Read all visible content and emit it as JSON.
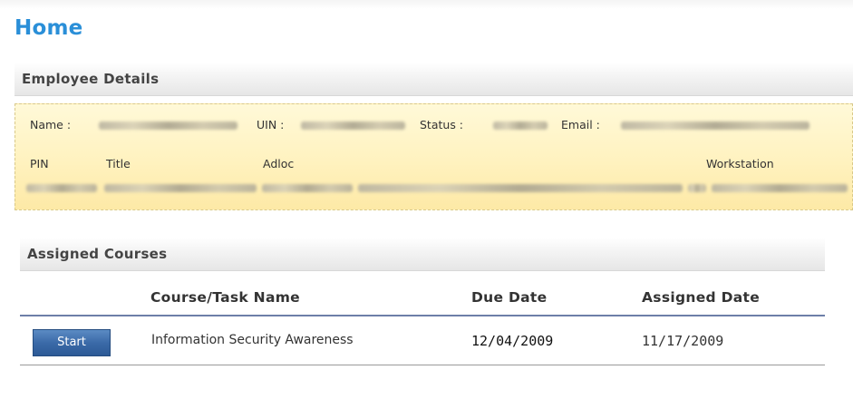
{
  "page": {
    "title": "Home"
  },
  "employee_details": {
    "heading": "Employee Details",
    "labels": {
      "name": "Name :",
      "uin": "UIN :",
      "status": "Status :",
      "email": "Email :",
      "pin": "PIN",
      "title": "Title",
      "adloc": "Adloc",
      "workstation": "Workstation"
    }
  },
  "assigned_courses": {
    "heading": "Assigned Courses",
    "columns": [
      "Course/Task Name",
      "Due Date",
      "Assigned Date"
    ],
    "rows": [
      {
        "action_label": "Start",
        "course": "Information Security Awareness",
        "due_date": "12/04/2009",
        "assigned_date": "11/17/2009"
      }
    ]
  },
  "colors": {
    "title": "#2a8fd8",
    "panel": "#fff2bf",
    "button": "#3b6aa8",
    "header_rule": "#6d7fa8"
  }
}
